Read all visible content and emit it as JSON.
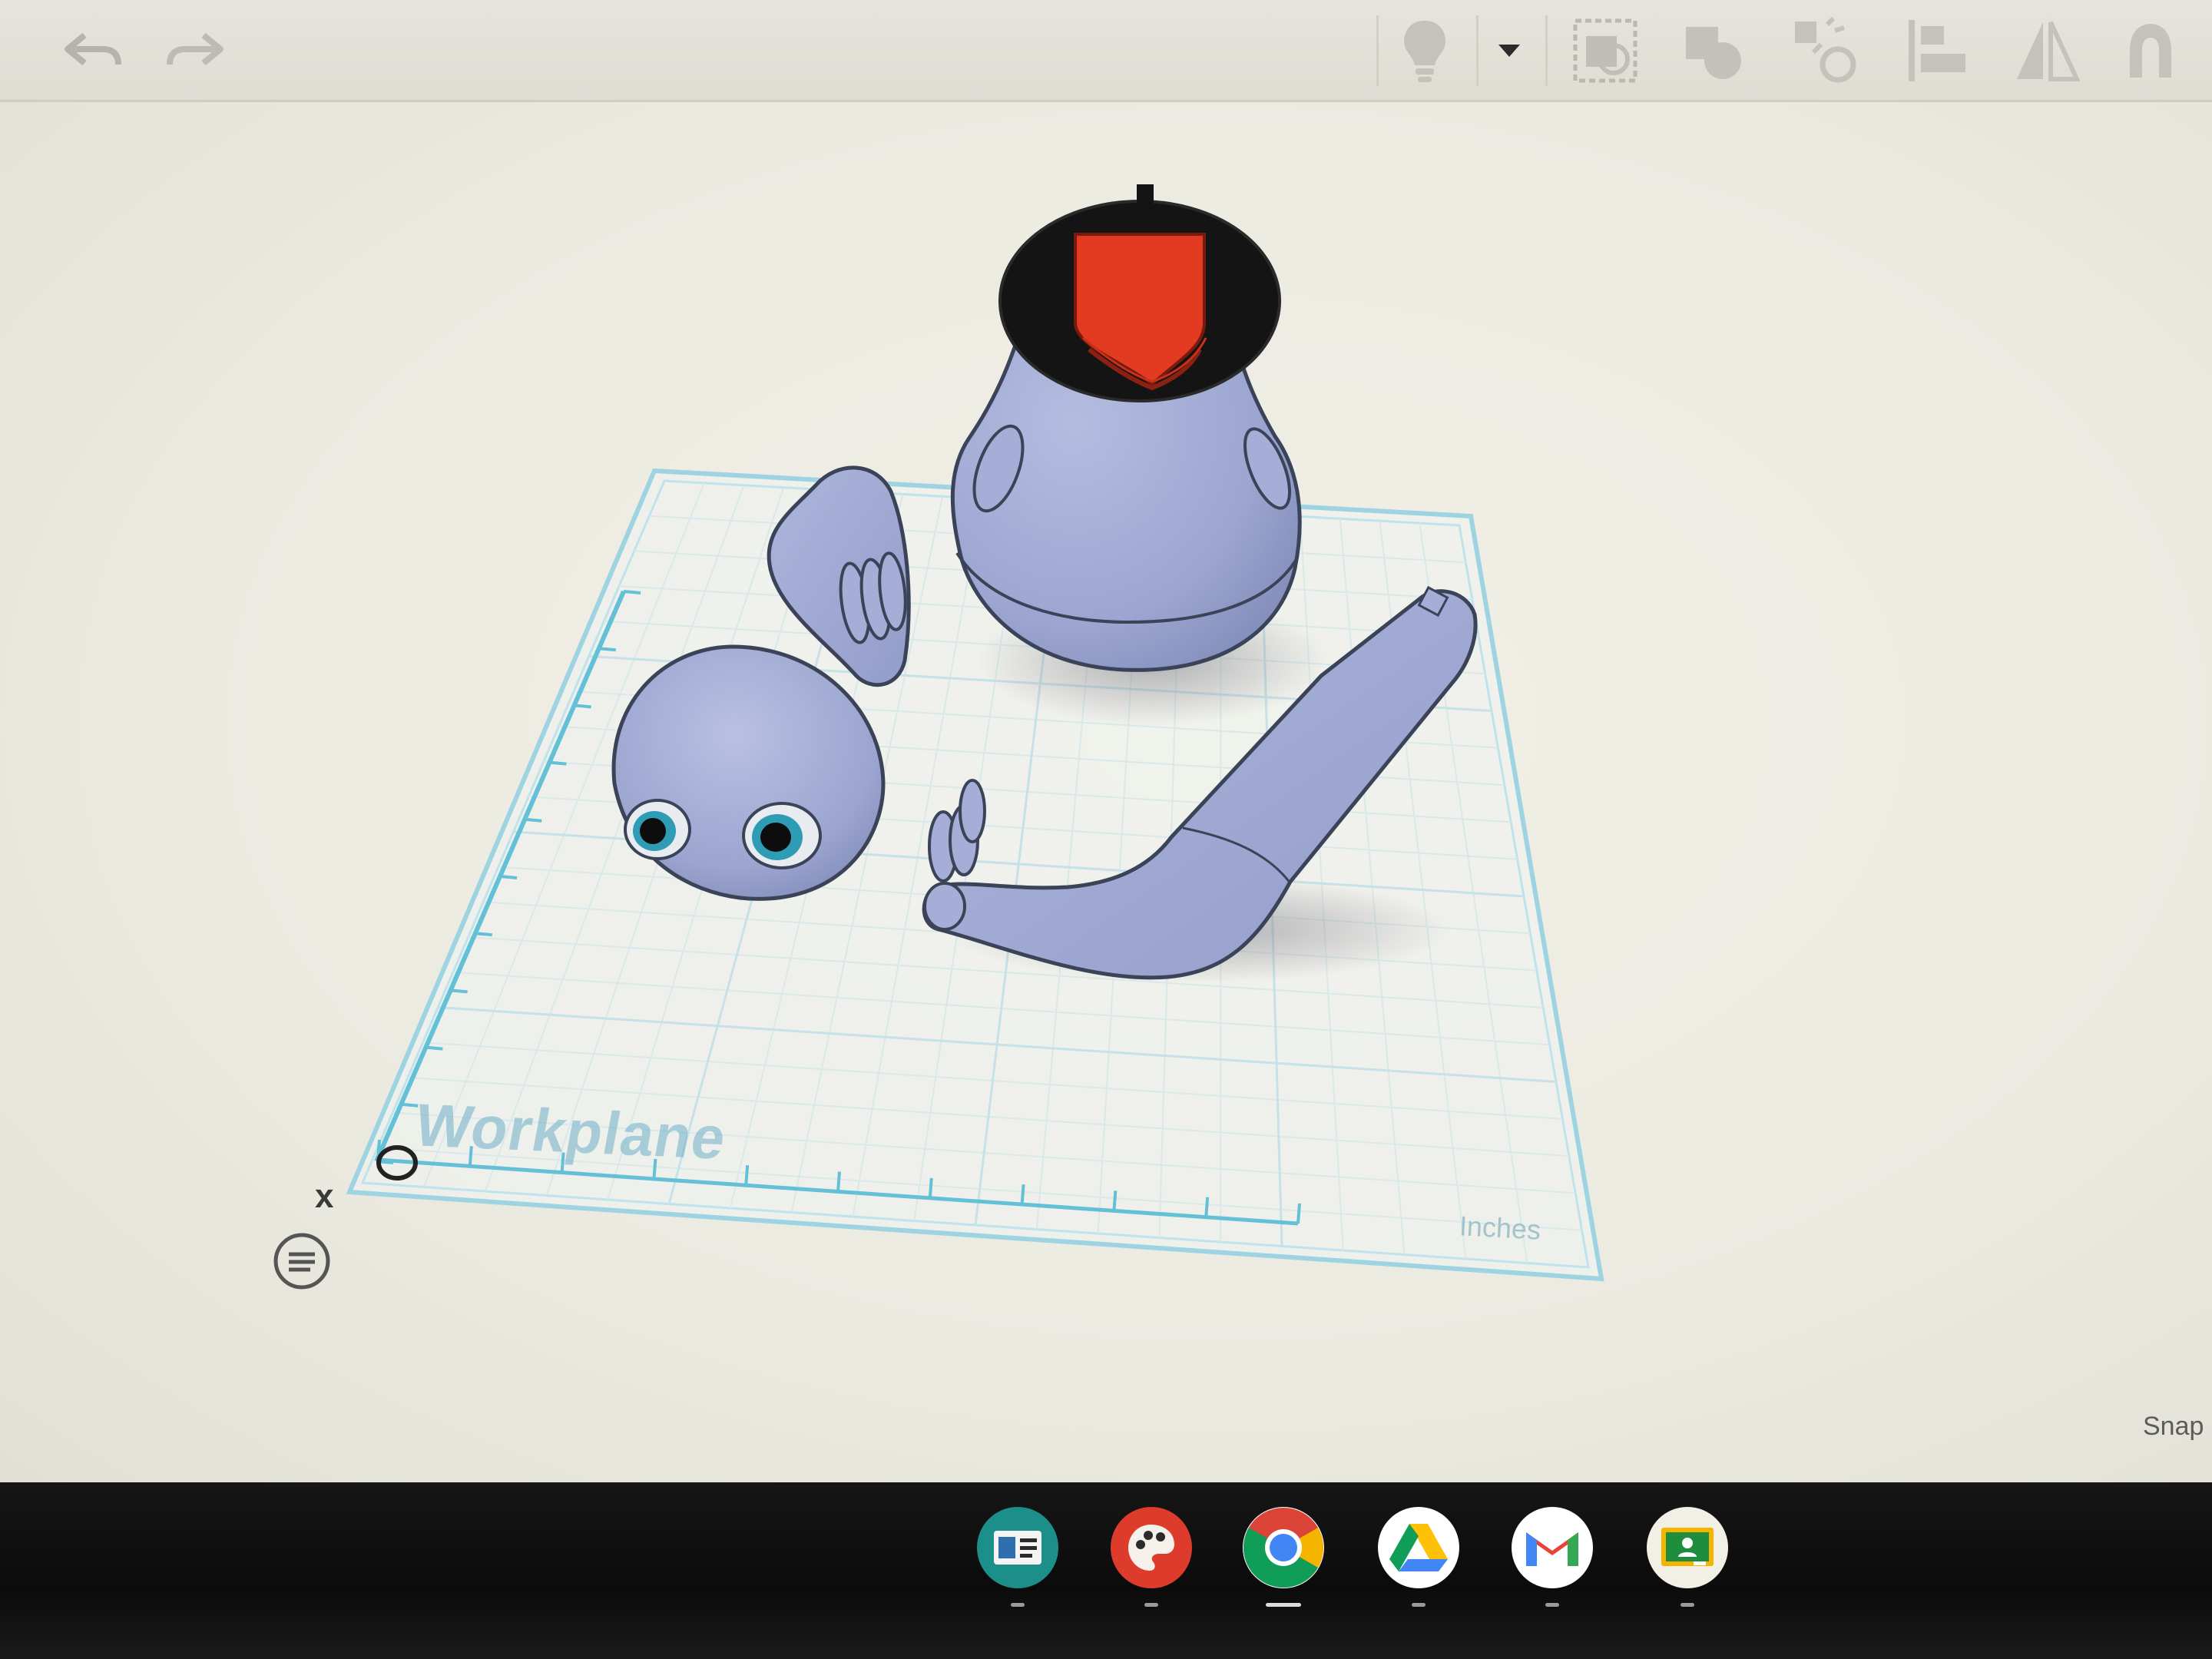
{
  "toolbar": {
    "left": [
      "undo-icon",
      "redo-icon"
    ],
    "right": [
      "lightbulb-icon",
      "dropdown-arrow-icon",
      "group-icon",
      "ungroup-icon",
      "align-icon",
      "flip-icon",
      "mirror-icon",
      "magnet-icon"
    ]
  },
  "workplane": {
    "label": "Workplane",
    "units": "Inches",
    "snap_label": "Snap",
    "axis_x_label": "x"
  },
  "colors": {
    "accent": "#63c0d6",
    "part_fill": "#9fa8d0",
    "part_outline": "#3b4358",
    "head_top": "#131313",
    "red_panel": "#e23b22"
  },
  "shelf": {
    "apps": [
      {
        "name": "classroom-cards-icon",
        "active": false
      },
      {
        "name": "canvas-paint-icon",
        "active": false
      },
      {
        "name": "chrome-icon",
        "active": true
      },
      {
        "name": "drive-icon",
        "active": false
      },
      {
        "name": "gmail-icon",
        "active": false
      },
      {
        "name": "classroom-icon",
        "active": false
      }
    ]
  }
}
